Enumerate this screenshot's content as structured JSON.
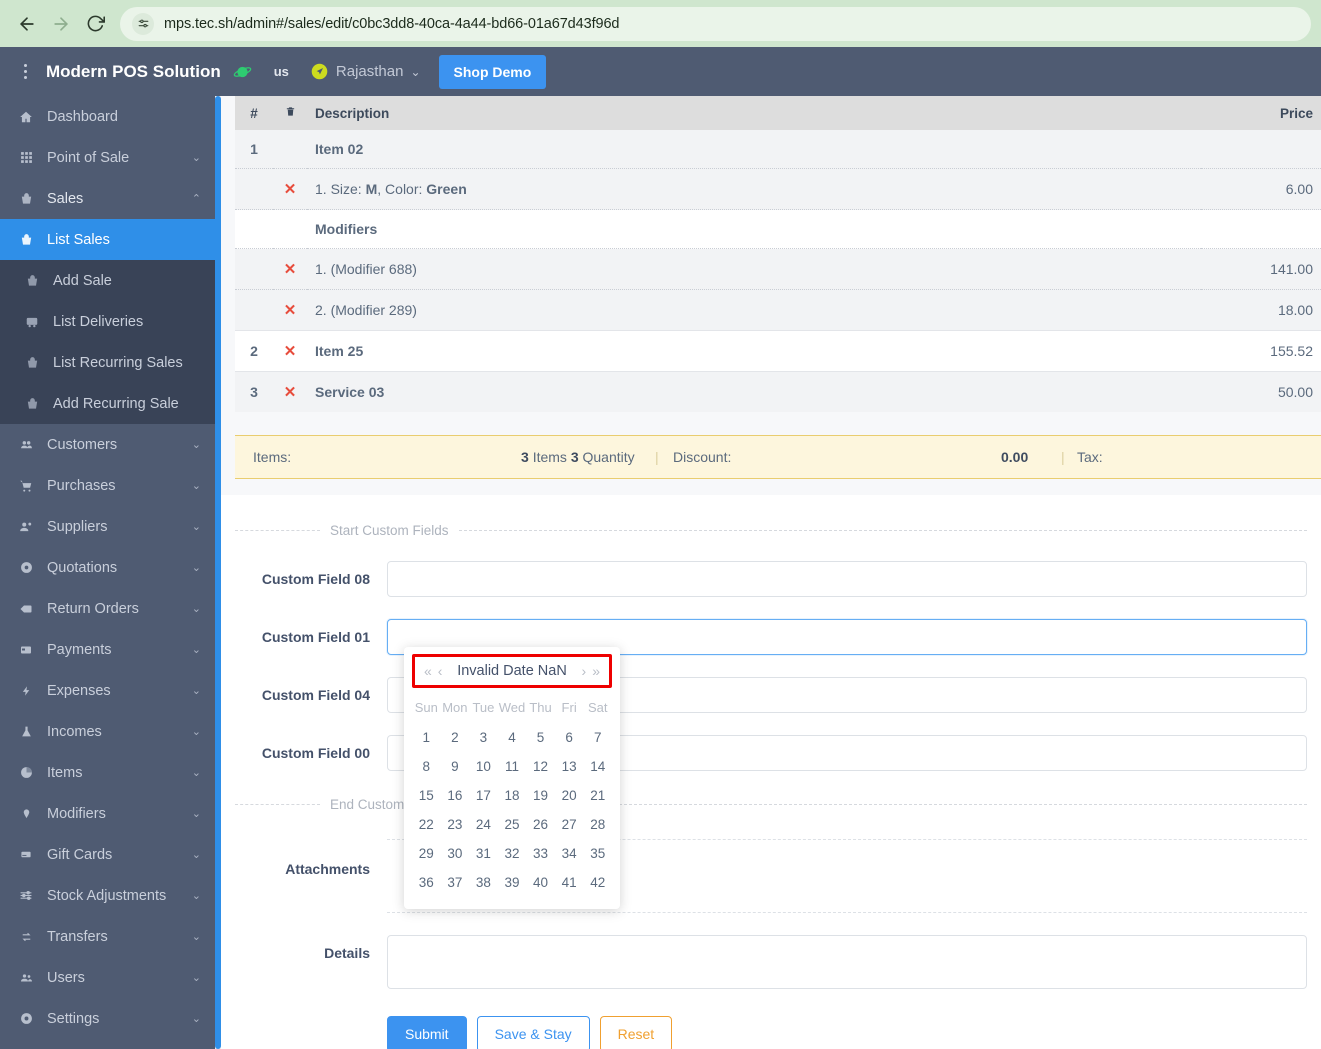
{
  "browser": {
    "back_icon": "back-arrow-icon",
    "forward_icon": "forward-arrow-icon",
    "reload_icon": "reload-icon",
    "site_settings_icon": "tune-icon",
    "url": "mps.tec.sh/admin#/sales/edit/c0bc3dd8-40ca-4a44-bd66-01a67d43f96d",
    "url_host": "mps.tec.sh",
    "bar_color": "#cfe6ce"
  },
  "appbar": {
    "menu_icon": "kebab-menu-icon",
    "brand": "Modern POS Solution",
    "planet_icon": "planet-icon",
    "locale": "us",
    "location_icon": "location-pin-icon",
    "region": "Rajasthan",
    "region_caret": "⌄",
    "shop_button": "Shop Demo",
    "bg_color": "#4f5b72",
    "accent_color": "#3c93f0"
  },
  "sidebar": {
    "active_color": "#2f8fe8",
    "items": [
      {
        "label": "Dashboard",
        "icon": "home-icon",
        "arrow": "",
        "state": "normal"
      },
      {
        "label": "Point of Sale",
        "icon": "grid-icon",
        "arrow": "⌄",
        "state": "normal"
      },
      {
        "label": "Sales",
        "icon": "basket-icon",
        "arrow": "⌃",
        "state": "expanded"
      },
      {
        "label": "List Sales",
        "icon": "basket-icon",
        "arrow": "",
        "state": "active"
      },
      {
        "label": "Add Sale",
        "icon": "basket-icon",
        "arrow": "",
        "state": "sub"
      },
      {
        "label": "List Deliveries",
        "icon": "truck-icon",
        "arrow": "",
        "state": "sub"
      },
      {
        "label": "List Recurring Sales",
        "icon": "basket-icon",
        "arrow": "",
        "state": "sub"
      },
      {
        "label": "Add Recurring Sale",
        "icon": "basket-icon",
        "arrow": "",
        "state": "sub"
      },
      {
        "label": "Customers",
        "icon": "people-icon",
        "arrow": "⌄",
        "state": "normal"
      },
      {
        "label": "Purchases",
        "icon": "cart-icon",
        "arrow": "⌄",
        "state": "normal"
      },
      {
        "label": "Suppliers",
        "icon": "supplier-icon",
        "arrow": "⌄",
        "state": "normal"
      },
      {
        "label": "Quotations",
        "icon": "dot-circle-icon",
        "arrow": "⌄",
        "state": "normal"
      },
      {
        "label": "Return Orders",
        "icon": "backspace-icon",
        "arrow": "⌄",
        "state": "normal"
      },
      {
        "label": "Payments",
        "icon": "card-icon",
        "arrow": "⌄",
        "state": "normal"
      },
      {
        "label": "Expenses",
        "icon": "bolt-icon",
        "arrow": "⌄",
        "state": "normal"
      },
      {
        "label": "Incomes",
        "icon": "flask-icon",
        "arrow": "⌄",
        "state": "normal"
      },
      {
        "label": "Items",
        "icon": "pie-icon",
        "arrow": "⌄",
        "state": "normal"
      },
      {
        "label": "Modifiers",
        "icon": "pin-icon",
        "arrow": "⌄",
        "state": "normal"
      },
      {
        "label": "Gift Cards",
        "icon": "giftcard-icon",
        "arrow": "⌄",
        "state": "normal"
      },
      {
        "label": "Stock Adjustments",
        "icon": "sliders-icon",
        "arrow": "⌄",
        "state": "normal"
      },
      {
        "label": "Transfers",
        "icon": "transfer-icon",
        "arrow": "⌄",
        "state": "normal"
      },
      {
        "label": "Users",
        "icon": "users-icon",
        "arrow": "⌄",
        "state": "normal"
      },
      {
        "label": "Settings",
        "icon": "gear-icon",
        "arrow": "⌄",
        "state": "normal"
      }
    ]
  },
  "items_table": {
    "headers": {
      "num": "#",
      "delete": "trash-icon",
      "description": "Description",
      "price": "Price"
    },
    "rows": [
      {
        "num": "1",
        "del": "",
        "desc": "Item 02",
        "desc_bold": true,
        "price": "",
        "shade": "shade",
        "border": "none"
      },
      {
        "num": "",
        "del": "✕",
        "desc_html": "1. Size: <b>M</b>, Color: <b>Green</b>",
        "desc": "1. Size: M, Color: Green",
        "desc_bold": false,
        "price": "6.00",
        "shade": "shade",
        "border": "dot"
      },
      {
        "num": "",
        "del": "",
        "desc": "Modifiers",
        "desc_bold": true,
        "price": "",
        "shade": "white",
        "border": "dot"
      },
      {
        "num": "",
        "del": "✕",
        "desc": "1. (Modifier 688)",
        "desc_bold": false,
        "price": "141.00",
        "shade": "shade",
        "border": "dot"
      },
      {
        "num": "",
        "del": "✕",
        "desc": "2. (Modifier 289)",
        "desc_bold": false,
        "price": "18.00",
        "shade": "shade",
        "border": "dot"
      },
      {
        "num": "2",
        "del": "✕",
        "desc": "Item 25",
        "desc_bold": true,
        "price": "155.52",
        "shade": "white",
        "border": "solid"
      },
      {
        "num": "3",
        "del": "✕",
        "desc": "Service 03",
        "desc_bold": true,
        "price": "50.00",
        "shade": "shade",
        "border": "solid"
      }
    ]
  },
  "summary": {
    "items_label": "Items:",
    "items_count": "3",
    "items_word": "Items",
    "qty_count": "3",
    "qty_word": "Quantity",
    "discount_label": "Discount:",
    "discount_value": "0.00",
    "tax_label": "Tax:",
    "bg_color": "#fdf6dd",
    "border_color": "#e9cd6f"
  },
  "form": {
    "start_divider": "Start Custom Fields",
    "end_divider": "End Custom Fields",
    "fields": [
      {
        "label": "Custom Field 08",
        "value": "",
        "placeholder": "",
        "focused": false
      },
      {
        "label": "Custom Field 01",
        "value": "",
        "placeholder": "",
        "focused": true
      },
      {
        "label": "Custom Field 04",
        "value": "",
        "placeholder": "",
        "focused": false
      },
      {
        "label": "Custom Field 00",
        "value": "",
        "placeholder": "",
        "focused": false
      }
    ],
    "attachments_label": "Attachments",
    "details_label": "Details",
    "details_value": "",
    "buttons": {
      "submit": "Submit",
      "save_stay": "Save & Stay",
      "reset": "Reset"
    }
  },
  "datepicker": {
    "prev_year_icon": "«",
    "prev_month_icon": "‹",
    "title": "Invalid Date NaN",
    "next_month_icon": "›",
    "next_year_icon": "»",
    "highlight_color": "#ee0000",
    "dow": [
      "Sun",
      "Mon",
      "Tue",
      "Wed",
      "Thu",
      "Fri",
      "Sat"
    ],
    "days": [
      "1",
      "2",
      "3",
      "4",
      "5",
      "6",
      "7",
      "8",
      "9",
      "10",
      "11",
      "12",
      "13",
      "14",
      "15",
      "16",
      "17",
      "18",
      "19",
      "20",
      "21",
      "22",
      "23",
      "24",
      "25",
      "26",
      "27",
      "28",
      "29",
      "30",
      "31",
      "32",
      "33",
      "34",
      "35",
      "36",
      "37",
      "38",
      "39",
      "40",
      "41",
      "42"
    ]
  }
}
